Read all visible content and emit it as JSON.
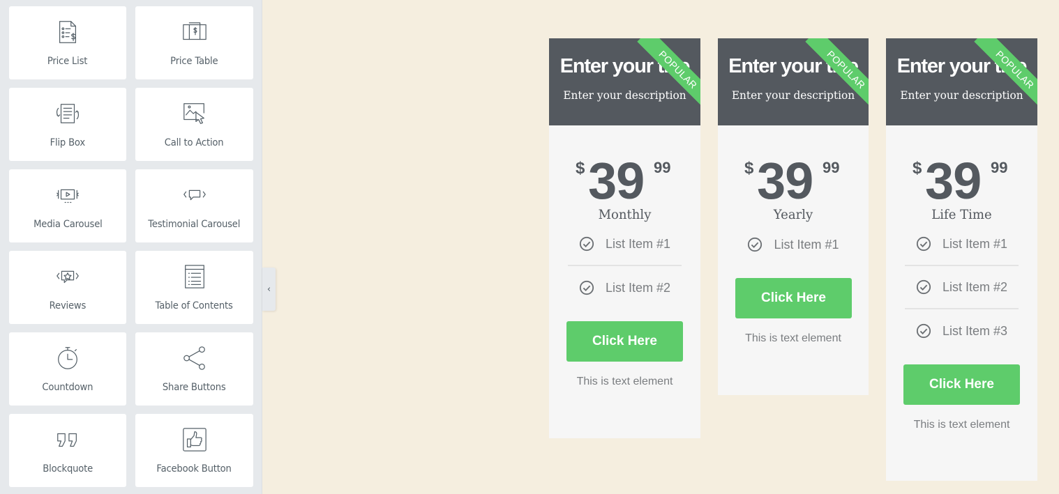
{
  "panel": {
    "widgets": [
      {
        "label": "Price List",
        "icon": "price-list-icon"
      },
      {
        "label": "Price Table",
        "icon": "price-table-icon"
      },
      {
        "label": "Flip Box",
        "icon": "flip-box-icon"
      },
      {
        "label": "Call to Action",
        "icon": "call-to-action-icon"
      },
      {
        "label": "Media Carousel",
        "icon": "media-carousel-icon"
      },
      {
        "label": "Testimonial Carousel",
        "icon": "testimonial-carousel-icon"
      },
      {
        "label": "Reviews",
        "icon": "reviews-icon"
      },
      {
        "label": "Table of Contents",
        "icon": "table-of-contents-icon"
      },
      {
        "label": "Countdown",
        "icon": "countdown-icon"
      },
      {
        "label": "Share Buttons",
        "icon": "share-buttons-icon"
      },
      {
        "label": "Blockquote",
        "icon": "blockquote-icon"
      },
      {
        "label": "Facebook Button",
        "icon": "facebook-button-icon"
      }
    ],
    "collapse_glyph": "‹"
  },
  "colors": {
    "canvas": "#f5eedf",
    "panel": "#e6e9ec",
    "card_header": "#54595f",
    "accent_green": "#5ecc6b",
    "card_body": "#f6f6f6"
  },
  "cards": [
    {
      "title": "Enter your title",
      "description": "Enter your description",
      "ribbon": "POPULAR",
      "currency": "$",
      "integer": "39",
      "fraction": "99",
      "period": "Monthly",
      "features": [
        "List Item #1",
        "List Item #2"
      ],
      "button": "Click Here",
      "note": "This is text element"
    },
    {
      "title": "Enter your title",
      "description": "Enter your description",
      "ribbon": "POPULAR",
      "currency": "$",
      "integer": "39",
      "fraction": "99",
      "period": "Yearly",
      "features": [
        "List Item #1"
      ],
      "button": "Click Here",
      "note": "This is text element"
    },
    {
      "title": "Enter your title",
      "description": "Enter your description",
      "ribbon": "POPULAR",
      "currency": "$",
      "integer": "39",
      "fraction": "99",
      "period": "Life Time",
      "features": [
        "List Item #1",
        "List Item #2",
        "List Item #3"
      ],
      "button": "Click Here",
      "note": "This is text element"
    }
  ]
}
